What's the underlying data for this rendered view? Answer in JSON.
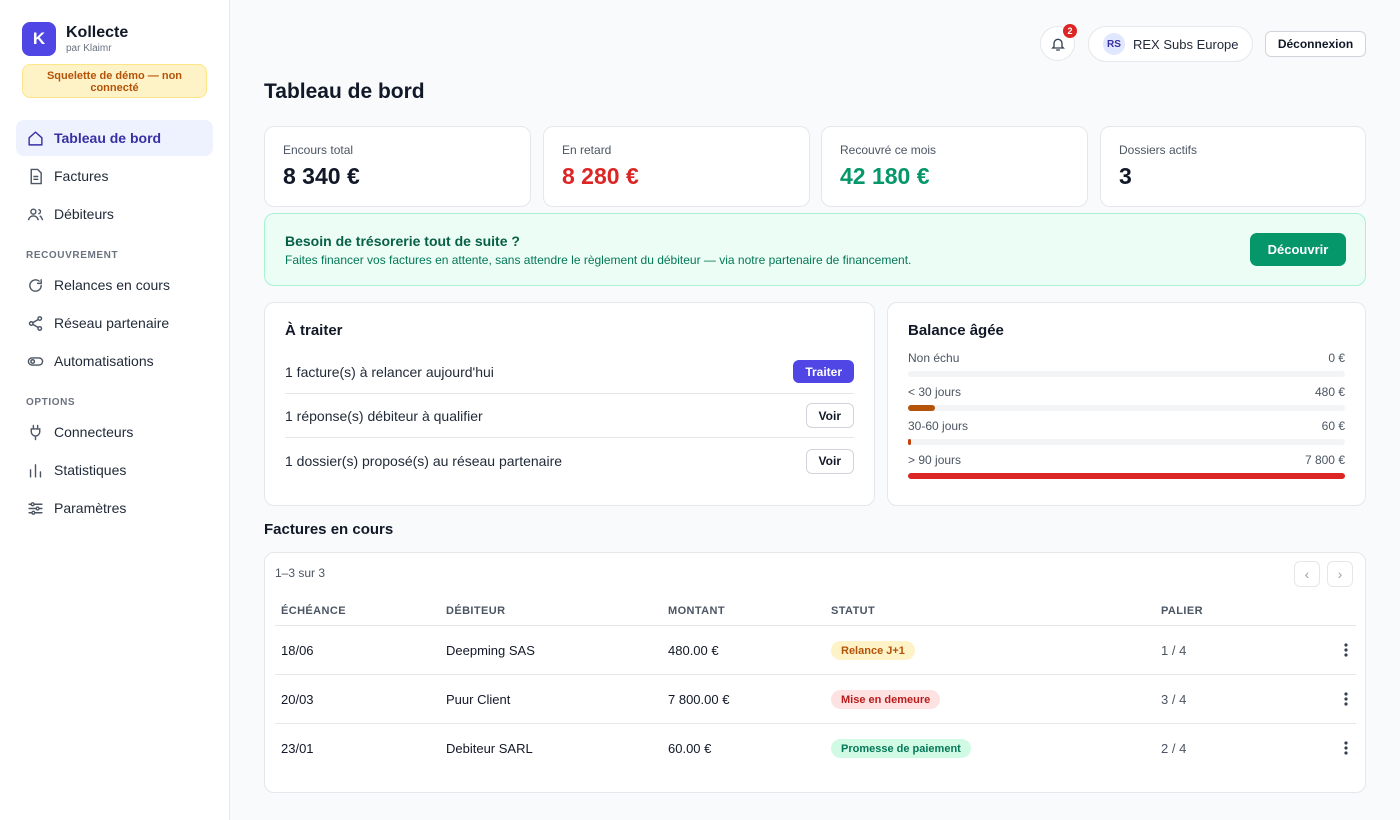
{
  "brand": {
    "initial": "K",
    "name": "Kollecte",
    "sub": "par Klaimr"
  },
  "demo_notice": "Squelette de démo — non connecté",
  "sidebar": {
    "items": [
      {
        "label": "Tableau de bord",
        "icon": "home-icon",
        "active": true
      },
      {
        "label": "Factures",
        "icon": "file-icon"
      },
      {
        "label": "Débiteurs",
        "icon": "users-icon"
      }
    ],
    "section_recouvrement": "RECOUVREMENT",
    "recouvrement_items": [
      {
        "label": "Relances en cours",
        "icon": "refresh-icon"
      },
      {
        "label": "Réseau partenaire",
        "icon": "share-icon"
      },
      {
        "label": "Automatisations",
        "icon": "toggle-icon"
      }
    ],
    "section_options": "OPTIONS",
    "options_items": [
      {
        "label": "Connecteurs",
        "icon": "plug-icon"
      },
      {
        "label": "Statistiques",
        "icon": "bar-chart-icon"
      },
      {
        "label": "Paramètres",
        "icon": "sliders-icon"
      }
    ]
  },
  "topbar": {
    "notification_count": "2",
    "user_initials": "RS",
    "user_name": "REX Subs Europe",
    "logout_label": "Déconnexion"
  },
  "page_title": "Tableau de bord",
  "kpis": [
    {
      "label": "Encours total",
      "value": "8 340 €",
      "color": "#111827"
    },
    {
      "label": "En retard",
      "value": "8 280 €",
      "color": "#dc2626"
    },
    {
      "label": "Recouvré ce mois",
      "value": "42 180 €",
      "color": "#059669"
    },
    {
      "label": "Dossiers actifs",
      "value": "3",
      "color": "#111827"
    }
  ],
  "banner": {
    "title": "Besoin de trésorerie tout de suite ?",
    "text": "Faites financer vos factures en attente, sans attendre le règlement du débiteur — via notre partenaire de financement.",
    "button": "Découvrir"
  },
  "todo": {
    "title": "À traiter",
    "rows": [
      {
        "text": "1 facture(s) à relancer aujourd'hui",
        "action": "Traiter"
      },
      {
        "text": "1 réponse(s) débiteur à qualifier",
        "action": "Voir"
      },
      {
        "text": "1 dossier(s) proposé(s) au réseau partenaire",
        "action": "Voir"
      }
    ]
  },
  "aged_balance": {
    "title": "Balance âgée",
    "max_value": 7800,
    "rows": [
      {
        "label": "Non échu",
        "amount": "0 €",
        "value": 0,
        "color": "#d97706"
      },
      {
        "label": "< 30 jours",
        "amount": "480 €",
        "value": 480,
        "color": "#b45309"
      },
      {
        "label": "30-60 jours",
        "amount": "60 €",
        "value": 60,
        "color": "#c2410c"
      },
      {
        "label": "> 90 jours",
        "amount": "7 800 €",
        "value": 7800,
        "color": "#dc2626"
      }
    ]
  },
  "invoices": {
    "title": "Factures en cours",
    "range": "1–3 sur 3",
    "prev": "‹",
    "next": "›",
    "columns": [
      "ÉCHÉANCE",
      "DÉBITEUR",
      "MONTANT",
      "STATUT",
      "PALIER"
    ],
    "rows": [
      {
        "due": "18/06",
        "debtor": "Deepming SAS",
        "amount": "480.00 €",
        "status": "Relance J+1",
        "status_bg": "#fef3c7",
        "status_fg": "#b45309",
        "step": "1 / 4"
      },
      {
        "due": "20/03",
        "debtor": "Puur Client",
        "amount": "7 800.00 €",
        "status": "Mise en demeure",
        "status_bg": "#fee2e2",
        "status_fg": "#b91c1c",
        "step": "3 / 4"
      },
      {
        "due": "23/01",
        "debtor": "Debiteur SARL",
        "amount": "60.00 €",
        "status": "Promesse de paiement",
        "status_bg": "#d1fae5",
        "status_fg": "#047857",
        "step": "2 / 4"
      }
    ]
  }
}
